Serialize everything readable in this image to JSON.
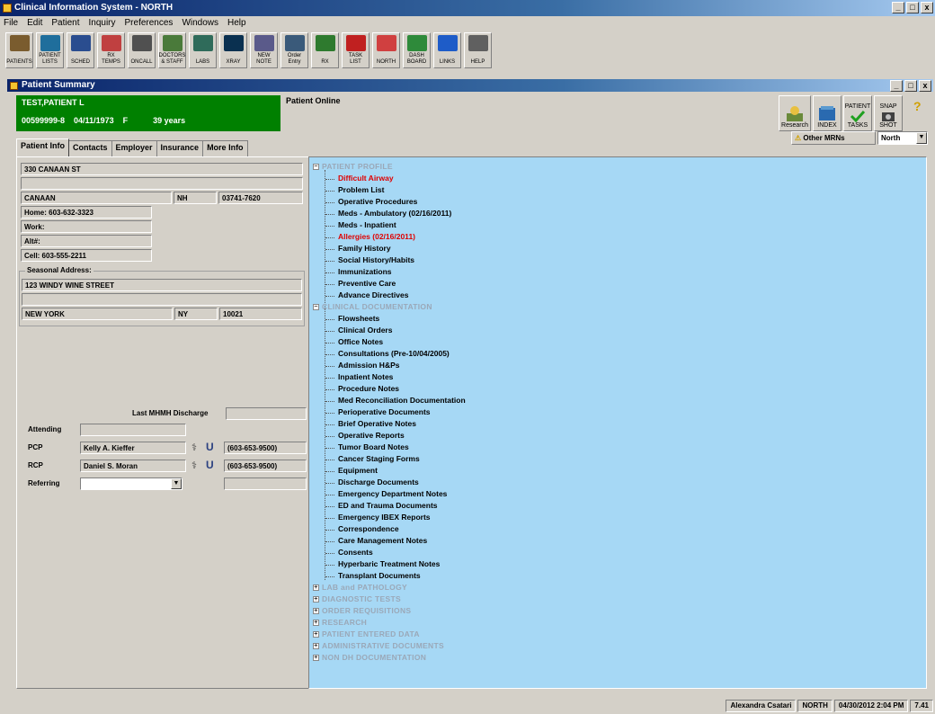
{
  "app": {
    "title": "Clinical Information System - NORTH",
    "window_controls": [
      "_",
      "□",
      "x"
    ]
  },
  "menu": [
    "File",
    "Edit",
    "Patient",
    "Inquiry",
    "Preferences",
    "Windows",
    "Help"
  ],
  "toolbar": [
    {
      "label": "PATIENTS",
      "icon": "patients-icon",
      "color": "#7a5c2e"
    },
    {
      "label": "PATIENT LISTS",
      "icon": "patient-lists-icon",
      "color": "#1f6e9c"
    },
    {
      "label": "SCHED",
      "icon": "schedule-icon",
      "color": "#2a4d8f"
    },
    {
      "label": "RX TEMPS",
      "icon": "rx-icon",
      "color": "#c04040"
    },
    {
      "label": "ONCALL",
      "icon": "phone-icon",
      "color": "#505050"
    },
    {
      "label": "DOCTORS & STAFF",
      "icon": "doctors-icon",
      "color": "#4a7a3a"
    },
    {
      "label": "LABS",
      "icon": "labs-icon",
      "color": "#2f6b5a"
    },
    {
      "label": "XRAY",
      "icon": "xray-icon",
      "color": "#0a3050"
    },
    {
      "label": "NEW NOTE",
      "icon": "new-note-icon",
      "color": "#5a5a8a"
    },
    {
      "label": "Order Entry",
      "icon": "order-entry-icon",
      "color": "#3a5a7a"
    },
    {
      "label": "RX",
      "icon": "prescription-icon",
      "color": "#2e7a2e"
    },
    {
      "label": "TASK LIST",
      "icon": "task-list-icon",
      "color": "#c02020"
    },
    {
      "label": "NORTH",
      "icon": "north-icon",
      "color": "#d04040"
    },
    {
      "label": "DASH BOARD",
      "icon": "dashboard-icon",
      "color": "#2e8a3a"
    },
    {
      "label": "LINKS",
      "icon": "links-icon",
      "color": "#1e5cc8"
    },
    {
      "label": "HELP",
      "icon": "help-icon",
      "color": "#606060"
    }
  ],
  "summary": {
    "title": "Patient Summary",
    "patient_name": "TEST,PATIENT L",
    "mrn": "00599999-8",
    "dob": "04/11/1973",
    "sex": "F",
    "age": "39 years",
    "online": "Patient Online"
  },
  "right_tools": [
    {
      "label": "Research",
      "icon": "research-icon"
    },
    {
      "label": "INDEX",
      "icon": "index-icon"
    },
    {
      "label": "PATIENT TASKS",
      "icon": "patient-tasks-icon"
    },
    {
      "label": "SNAP SHOT",
      "icon": "snapshot-icon"
    }
  ],
  "other_mrns": {
    "label": "Other MRNs",
    "selected": "North"
  },
  "tabs": [
    "Patient Info",
    "Contacts",
    "Employer",
    "Insurance",
    "More Info"
  ],
  "address": {
    "line1": "330 CANAAN ST",
    "line2": "",
    "city": "CANAAN",
    "state": "NH",
    "zip": "03741-7620",
    "home": "Home: 603-632-3323",
    "work": "Work:",
    "alt": "Alt#:",
    "cell": "Cell: 603-555-2211"
  },
  "seasonal": {
    "label": "Seasonal Address:",
    "line1": "123 WINDY WINE STREET",
    "line2": "",
    "city": "NEW YORK",
    "state": "NY",
    "zip": "10021"
  },
  "care": {
    "last_discharge_label": "Last MHMH Discharge",
    "last_discharge": "",
    "attending_label": "Attending",
    "attending": "",
    "pcp_label": "PCP",
    "pcp": "Kelly A. Kieffer",
    "pcp_phone": "(603-653-9500)",
    "rcp_label": "RCP",
    "rcp": "Daniel S. Moran",
    "rcp_phone": "(603-653-9500)",
    "referring_label": "Referring",
    "referring": "",
    "referring_phone": ""
  },
  "tree": [
    {
      "kind": "section",
      "text": "PATIENT PROFILE",
      "open": true
    },
    {
      "kind": "leaf",
      "text": "Difficult Airway",
      "color": "#e00000"
    },
    {
      "kind": "leaf",
      "text": "Problem List"
    },
    {
      "kind": "leaf",
      "text": "Operative Procedures"
    },
    {
      "kind": "leaf",
      "text": "Meds - Ambulatory (02/16/2011)"
    },
    {
      "kind": "leaf",
      "text": "Meds - Inpatient"
    },
    {
      "kind": "leaf",
      "text": "Allergies (02/16/2011)",
      "color": "#e00000"
    },
    {
      "kind": "leaf",
      "text": "Family History"
    },
    {
      "kind": "leaf",
      "text": "Social History/Habits"
    },
    {
      "kind": "leaf",
      "text": "Immunizations"
    },
    {
      "kind": "leaf",
      "text": "Preventive Care"
    },
    {
      "kind": "leaf",
      "text": "Advance Directives"
    },
    {
      "kind": "section",
      "text": "CLINICAL DOCUMENTATION",
      "open": true
    },
    {
      "kind": "leaf",
      "text": "Flowsheets"
    },
    {
      "kind": "leaf",
      "text": "Clinical Orders"
    },
    {
      "kind": "leaf",
      "text": "Office Notes"
    },
    {
      "kind": "leaf",
      "text": "Consultations (Pre-10/04/2005)"
    },
    {
      "kind": "leaf",
      "text": "Admission H&Ps"
    },
    {
      "kind": "leaf",
      "text": "Inpatient Notes"
    },
    {
      "kind": "leaf",
      "text": "Procedure Notes"
    },
    {
      "kind": "leaf",
      "text": "Med Reconciliation Documentation"
    },
    {
      "kind": "leaf",
      "text": "Perioperative Documents"
    },
    {
      "kind": "leaf",
      "text": "Brief Operative Notes"
    },
    {
      "kind": "leaf",
      "text": "Operative Reports"
    },
    {
      "kind": "leaf",
      "text": "Tumor Board Notes"
    },
    {
      "kind": "leaf",
      "text": "Cancer Staging Forms"
    },
    {
      "kind": "leaf",
      "text": "Equipment"
    },
    {
      "kind": "leaf",
      "text": "Discharge Documents"
    },
    {
      "kind": "leaf",
      "text": "Emergency Department Notes"
    },
    {
      "kind": "leaf",
      "text": "ED and Trauma Documents"
    },
    {
      "kind": "leaf",
      "text": "Emergency IBEX Reports"
    },
    {
      "kind": "leaf",
      "text": "Correspondence"
    },
    {
      "kind": "leaf",
      "text": "Care Management Notes"
    },
    {
      "kind": "leaf",
      "text": "Consents"
    },
    {
      "kind": "leaf",
      "text": "Hyperbaric Treatment Notes"
    },
    {
      "kind": "leaf",
      "text": "Transplant Documents"
    },
    {
      "kind": "section",
      "text": "LAB and PATHOLOGY",
      "open": false
    },
    {
      "kind": "section",
      "text": "DIAGNOSTIC TESTS",
      "open": false
    },
    {
      "kind": "section",
      "text": "ORDER REQUISITIONS",
      "open": false
    },
    {
      "kind": "section",
      "text": "RESEARCH",
      "open": false
    },
    {
      "kind": "section",
      "text": "PATIENT ENTERED DATA",
      "open": false
    },
    {
      "kind": "section",
      "text": "ADMINISTRATIVE DOCUMENTS",
      "open": false
    },
    {
      "kind": "section",
      "text": "NON DH DOCUMENTATION",
      "open": false
    }
  ],
  "status": {
    "user": "Alexandra Csatari",
    "site": "NORTH",
    "datetime": "04/30/2012 2:04 PM",
    "version": "7.41"
  }
}
